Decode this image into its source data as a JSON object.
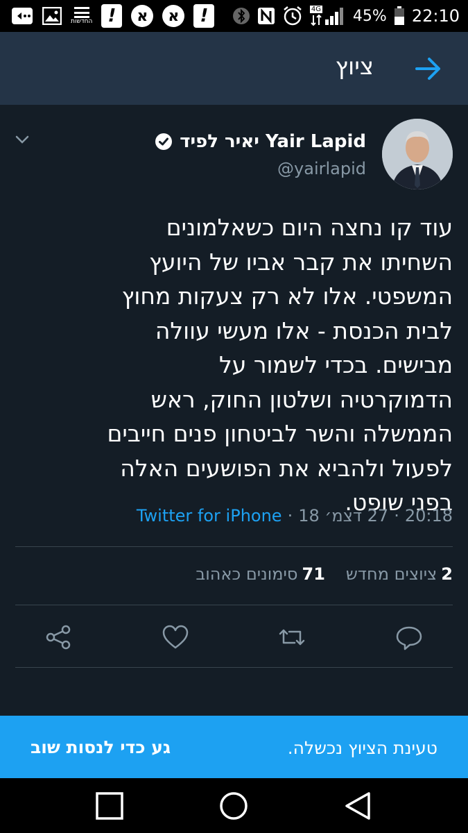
{
  "status_bar": {
    "news_label": "החדשות",
    "battery": "45%",
    "time": "22:10",
    "network": "4G",
    "icons": [
      "whatsapp-icon",
      "gallery-icon",
      "news-icon",
      "ynet-icon",
      "walla-icon",
      "walla-icon",
      "ynet-icon",
      "bluetooth-icon",
      "nfc-icon",
      "alarm-icon",
      "signal-icon",
      "battery-icon"
    ]
  },
  "header": {
    "title": "ציוץ",
    "back_icon": "arrow-right-icon"
  },
  "tweet": {
    "display_name": "יאיר לפיד Yair Lapid",
    "handle": "@yairlapid",
    "text": "עוד קו נחצה היום כשאלמונים השחיתו את קבר אביו של היועץ המשפטי. אלו לא רק צעקות מחוץ לבית הכנסת - אלו מעשי עוולה מבישים. בכדי לשמור על הדמוקרטיה ושלטון החוק, ראש הממשלה והשר לביטחון פנים חייבים לפעול ולהביא את הפושעים האלה בפני שופט.",
    "time": "20:18",
    "date": "27 דצמ׳ 18",
    "source": "Twitter for iPhone",
    "separator": "·"
  },
  "stats": {
    "retweets_count": "2",
    "retweets_label": "ציוצים מחדש",
    "likes_count": "71",
    "likes_label": "סימונים כאהוב"
  },
  "actions": [
    "reply-icon",
    "retweet-icon",
    "like-icon",
    "share-icon"
  ],
  "snackbar": {
    "message": "טעינת הציוץ נכשלה.",
    "action": "גע כדי לנסות שוב"
  },
  "colors": {
    "background": "#141d26",
    "header": "#243447",
    "accent": "#1da1f2",
    "secondary_text": "#8899a6",
    "divider": "#38444d"
  }
}
